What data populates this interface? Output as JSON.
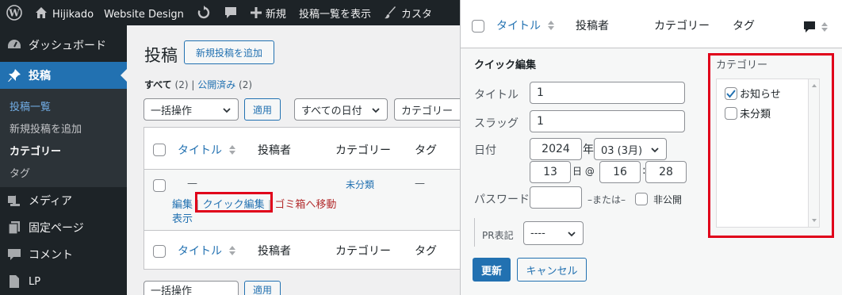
{
  "admin_bar": {
    "site_name": "Hijikado　Website Design",
    "new_label": "新規",
    "view_posts_label": "投稿一覧を表示",
    "customize_label": "カスタ"
  },
  "sidebar": {
    "dashboard": "ダッシュボード",
    "posts": "投稿",
    "submenu": [
      "投稿一覧",
      "新規投稿を追加",
      "カテゴリー",
      "タグ"
    ],
    "media": "メディア",
    "pages": "固定ページ",
    "comments": "コメント",
    "lp": "LP"
  },
  "main": {
    "title": "投稿",
    "add_new": "新規投稿を追加",
    "views": {
      "all": "すべて",
      "all_count": "(2)",
      "published": "公開済み",
      "published_count": "(2)"
    },
    "bulk_action": "一括操作",
    "apply": "適用",
    "dates": "すべての日付",
    "categories": "カテゴリー",
    "columns": {
      "title": "タイトル",
      "author": "投稿者",
      "category": "カテゴリー",
      "tag": "タグ"
    },
    "row": {
      "title": "—",
      "category": "未分類",
      "tag": "—",
      "actions": {
        "edit": "編集",
        "quick_edit": "クイック編集",
        "trash": "ゴミ箱へ移動",
        "view": "表示"
      }
    },
    "bottom_bulk": "一括操作",
    "bottom_apply": "適用"
  },
  "quick_edit": {
    "columns": {
      "title": "タイトル",
      "author": "投稿者",
      "category": "カテゴリー",
      "tag": "タグ"
    },
    "heading": "クイック編集",
    "title_label": "タイトル",
    "title_value": "1",
    "slug_label": "スラッグ",
    "slug_value": "1",
    "date_label": "日付",
    "year": "2024",
    "year_suffix": "年",
    "month": "03 (3月)",
    "day": "13",
    "day_suffix": "日 @",
    "hour": "16",
    "colon": ":",
    "minute": "28",
    "password_label": "パスワード",
    "password_value": "",
    "or_label": "–または–",
    "private_label": "非公開",
    "pr_label": "PR表記",
    "pr_value": "----",
    "update": "更新",
    "cancel": "キャンセル",
    "category_heading": "カテゴリー",
    "categories": [
      {
        "name": "お知らせ",
        "checked": true
      },
      {
        "name": "未分類",
        "checked": false
      }
    ]
  },
  "colors": {
    "accent": "#2271b1",
    "highlight": "#e0001a",
    "admin_dark": "#1d2327"
  }
}
